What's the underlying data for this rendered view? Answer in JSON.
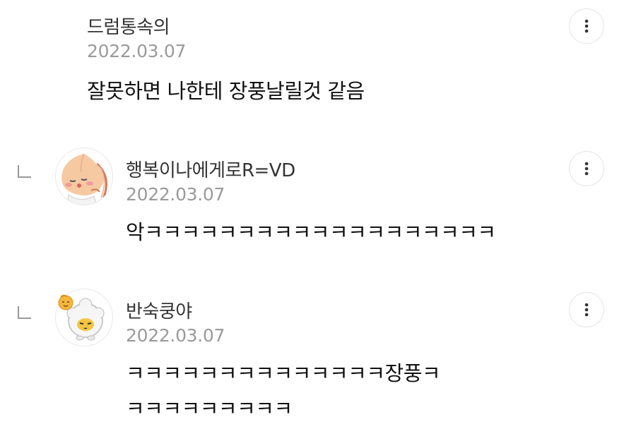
{
  "comments": [
    {
      "author": "드럼통속의",
      "date": "2022.03.07",
      "lines": [
        "잘못하면 나한테 장풍날릴것 같음"
      ]
    },
    {
      "author": "행복이나에게로R=VD",
      "date": "2022.03.07",
      "lines": [
        "악ㅋㅋㅋㅋㅋㅋㅋㅋㅋㅋㅋㅋㅋㅋㅋㅋㅋㅋㅋ"
      ]
    },
    {
      "author": "반숙쿵야",
      "date": "2022.03.07",
      "lines": [
        "ㅋㅋㅋㅋㅋㅋㅋㅋㅋㅋㅋㅋㅋㅋ장풍ㅋ",
        "ㅋㅋㅋㅋㅋㅋㅋㅋㅋ"
      ]
    }
  ],
  "icons": {
    "more": "more-vertical-icon",
    "reply": "reply-indent-icon"
  },
  "colors": {
    "author": "#333333",
    "date": "#9a9a9a",
    "body": "#111111",
    "border": "#e3e3e3"
  }
}
